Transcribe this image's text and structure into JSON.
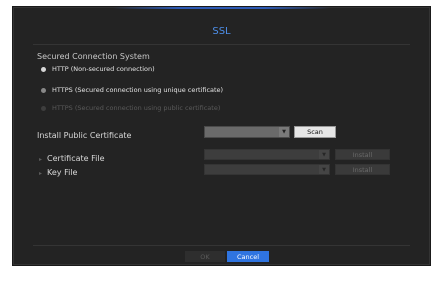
{
  "dialog": {
    "title": "SSL"
  },
  "secured_connection": {
    "title": "Secured Connection System",
    "options": [
      {
        "label": "HTTP (Non-secured connection)",
        "selected": true,
        "enabled": true
      },
      {
        "label": "HTTPS (Secured connection using unique certificate)",
        "selected": false,
        "enabled": true
      },
      {
        "label": "HTTPS (Secured connection using public certificate)",
        "selected": false,
        "enabled": false
      }
    ]
  },
  "install_public_certificate": {
    "label": "Install Public Certificate",
    "selected_value": "",
    "scan_label": "Scan"
  },
  "certificate_file": {
    "label": "Certificate File",
    "selected_value": "",
    "install_label": "Install"
  },
  "key_file": {
    "label": "Key File",
    "selected_value": "",
    "install_label": "Install"
  },
  "footer": {
    "ok_label": "OK",
    "cancel_label": "Cancel"
  },
  "colors": {
    "accent": "#2f74e0",
    "title": "#4d8ee8",
    "background": "#232323"
  },
  "icons": {
    "dropdown": "chevron-down-icon",
    "row_marker": "chevron-right-icon",
    "radio": "radio-icon"
  }
}
